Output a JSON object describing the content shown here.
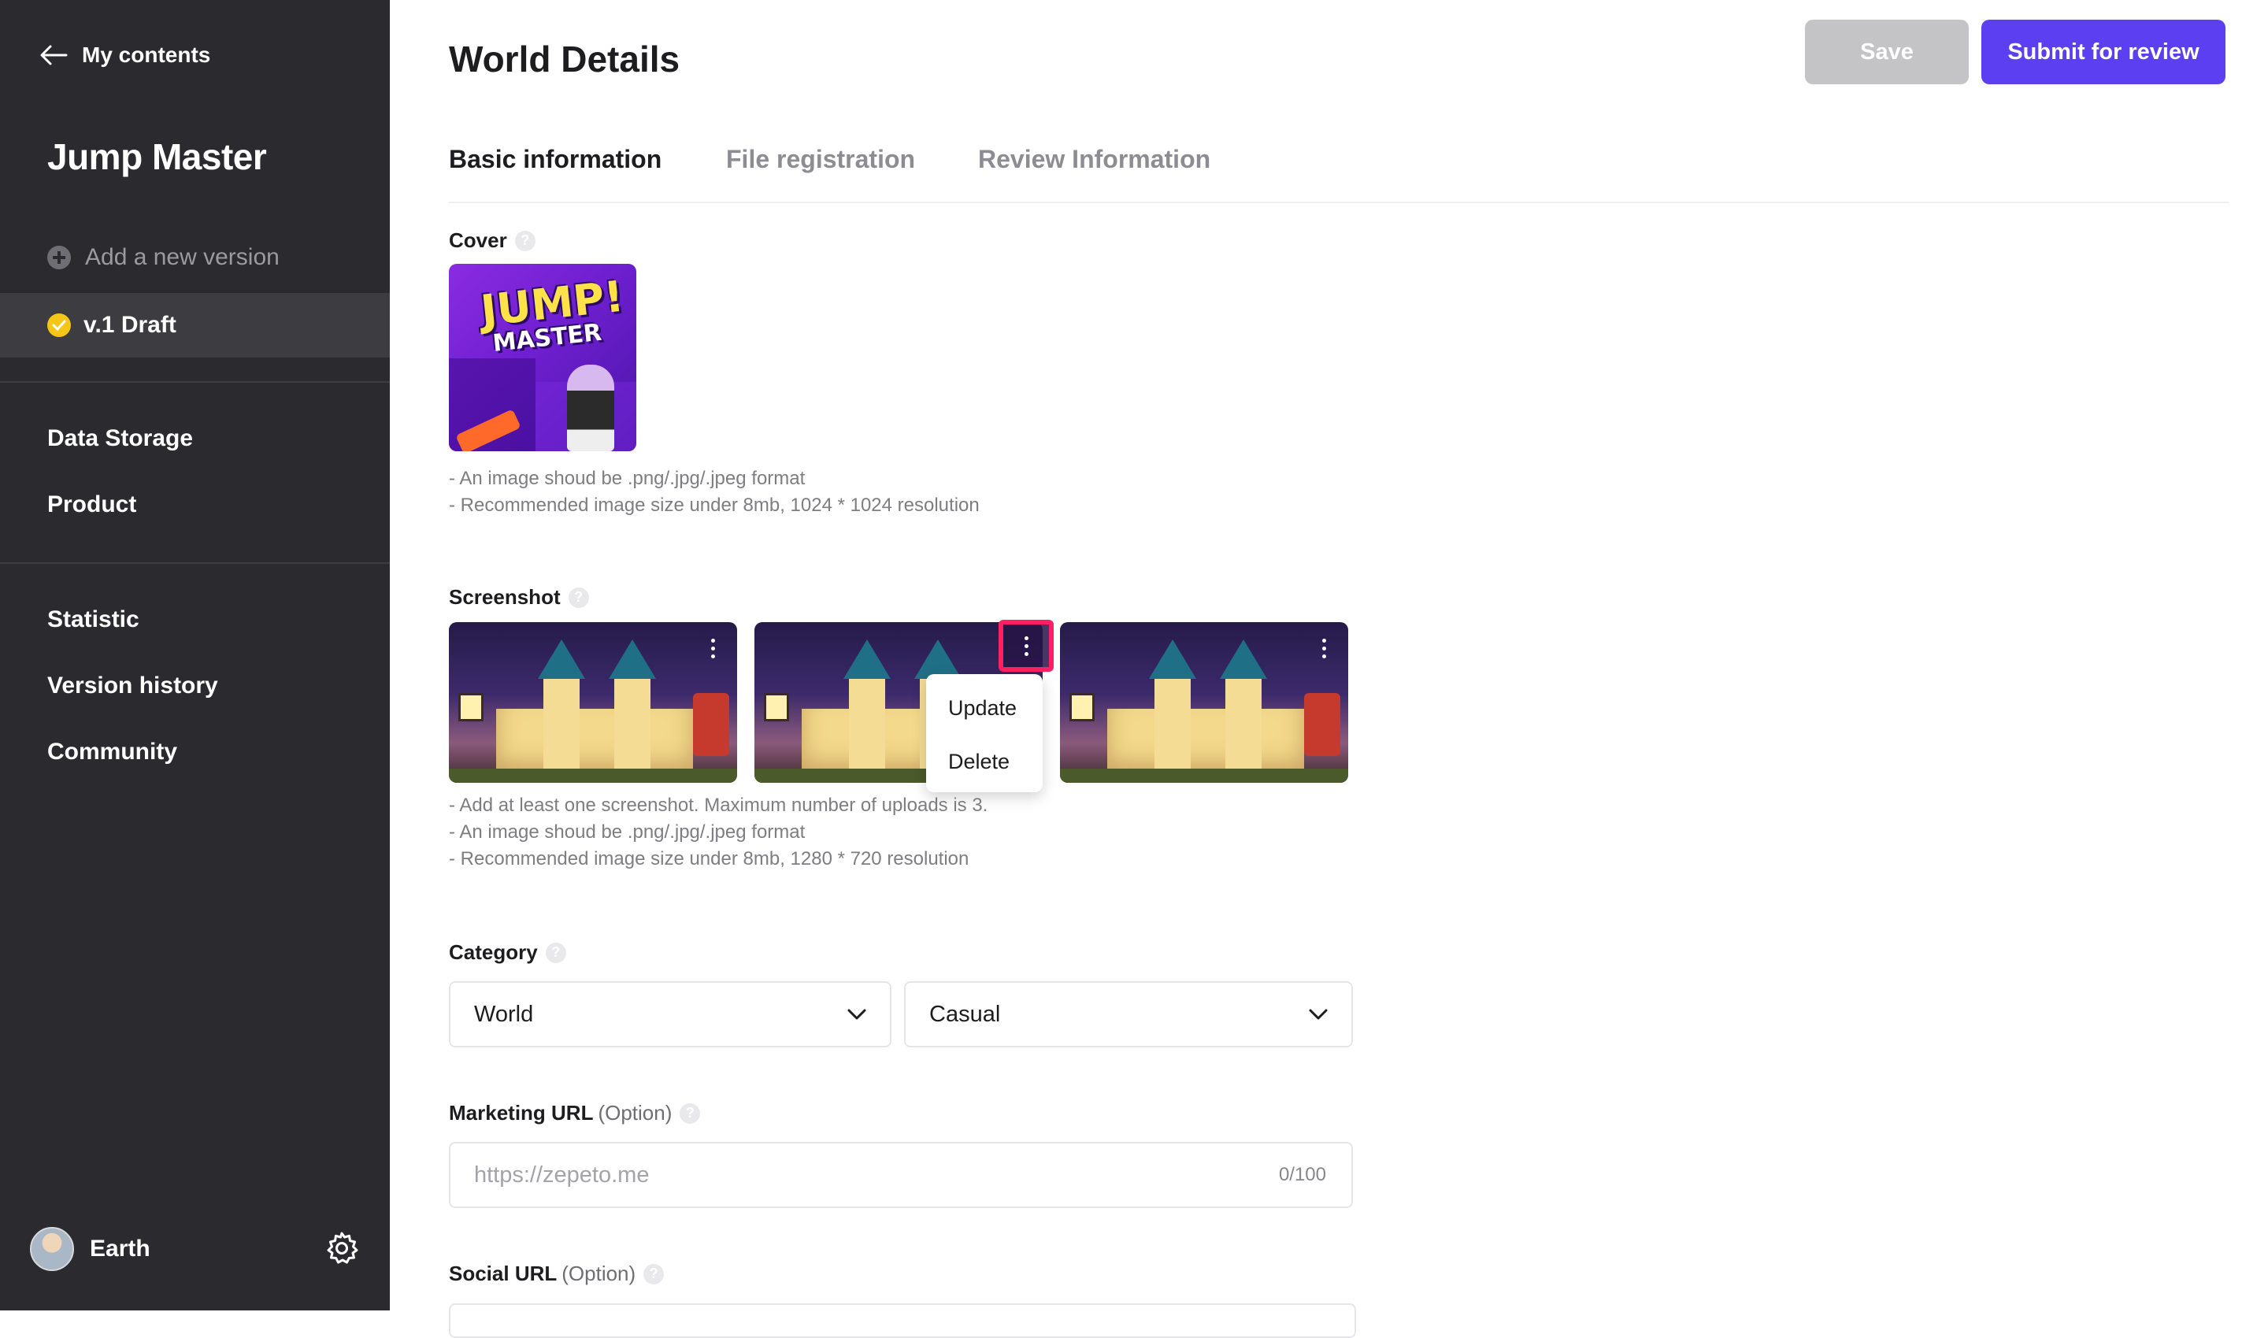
{
  "sidebar": {
    "back_label": "My contents",
    "project_title": "Jump Master",
    "add_version_label": "Add a new version",
    "current_version_label": "v.1 Draft",
    "nav_group_1": [
      "Data Storage",
      "Product"
    ],
    "nav_group_2": [
      "Statistic",
      "Version history",
      "Community"
    ],
    "user_name": "Earth"
  },
  "header": {
    "title": "World Details",
    "save_label": "Save",
    "submit_label": "Submit for review"
  },
  "tabs": [
    {
      "label": "Basic information",
      "active": true
    },
    {
      "label": "File registration",
      "active": false
    },
    {
      "label": "Review Information",
      "active": false
    }
  ],
  "cover": {
    "label": "Cover",
    "image_text_1": "JUMP!",
    "image_text_2": "MASTER",
    "hints": [
      "- An image shoud be .png/.jpg/.jpeg format",
      "- Recommended image size under 8mb, 1024 * 1024 resolution"
    ]
  },
  "screenshot": {
    "label": "Screenshot",
    "menu": {
      "update_label": "Update",
      "delete_label": "Delete"
    },
    "hints": [
      "- Add at least one screenshot. Maximum number of uploads is 3.",
      "- An image shoud be .png/.jpg/.jpeg format",
      "- Recommended image size under 8mb, 1280 * 720 resolution"
    ]
  },
  "category": {
    "label": "Category",
    "primary_value": "World",
    "secondary_value": "Casual"
  },
  "marketing_url": {
    "label": "Marketing URL",
    "option_label": "(Option)",
    "placeholder": "https://zepeto.me",
    "counter": "0/100"
  },
  "social_url": {
    "label": "Social URL",
    "option_label": "(Option)"
  },
  "colors": {
    "sidebar_bg": "#2b2b2f",
    "accent": "#5b3ff0",
    "highlight": "#ff1f64",
    "disabled_button": "#c4c4c7"
  }
}
